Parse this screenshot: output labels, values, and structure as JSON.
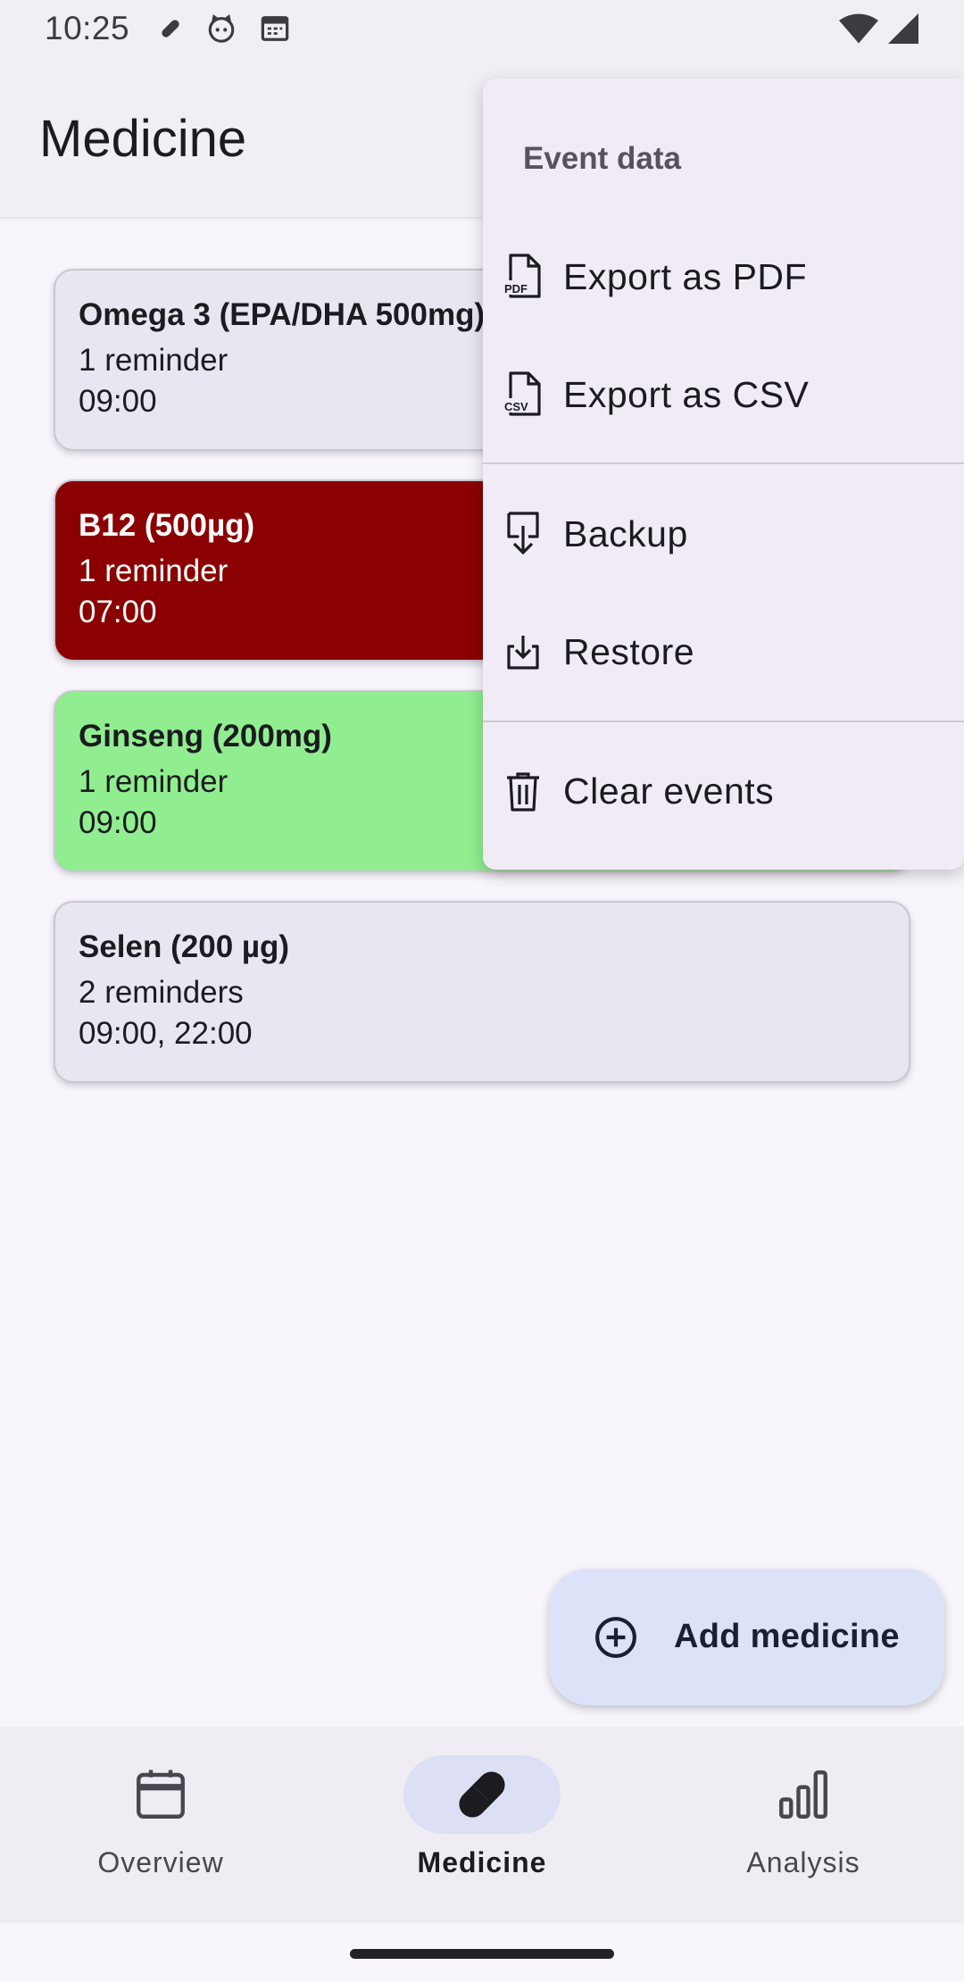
{
  "status_bar": {
    "time": "10:25"
  },
  "app_bar": {
    "title": "Medicine"
  },
  "medicines": [
    {
      "name": "Omega 3 (EPA/DHA 500mg)",
      "reminders": "1 reminder",
      "times": "09:00",
      "color": "#e8e6f0",
      "text_color": "#1c1b20"
    },
    {
      "name": "B12 (500µg)",
      "reminders": "1 reminder",
      "times": "07:00",
      "color": "#8b0000",
      "text_color": "#ffffff"
    },
    {
      "name": "Ginseng (200mg)",
      "reminders": "1 reminder",
      "times": "09:00",
      "color": "#90ee90",
      "text_color": "#1c1b20"
    },
    {
      "name": "Selen (200 µg)",
      "reminders": "2 reminders",
      "times": "09:00, 22:00",
      "color": "#e8e6f0",
      "text_color": "#1c1b20"
    }
  ],
  "menu": {
    "header": "Event data",
    "items": [
      {
        "label": "Export as PDF",
        "icon": "pdf-file-icon"
      },
      {
        "label": "Export as CSV",
        "icon": "csv-file-icon"
      },
      {
        "label": "Backup",
        "icon": "backup-icon"
      },
      {
        "label": "Restore",
        "icon": "restore-icon"
      },
      {
        "label": "Clear events",
        "icon": "trash-icon"
      }
    ]
  },
  "fab": {
    "label": "Add medicine",
    "icon": "add-circle-icon"
  },
  "bottom_nav": {
    "items": [
      {
        "label": "Overview",
        "icon": "calendar-icon",
        "active": false
      },
      {
        "label": "Medicine",
        "icon": "pill-icon",
        "active": true
      },
      {
        "label": "Analysis",
        "icon": "bar-chart-icon",
        "active": false
      }
    ]
  },
  "colors": {
    "accent": "#dce2f8",
    "surface": "#f8f6fc",
    "menu_bg": "#f1ebf5"
  }
}
